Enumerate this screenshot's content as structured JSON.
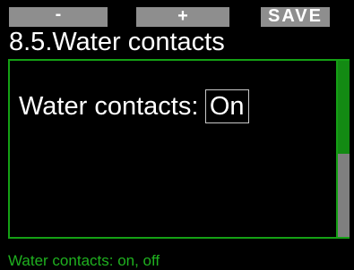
{
  "softkeys": {
    "left_label": "-",
    "middle_label": "+",
    "right_label": "SAVE"
  },
  "header": {
    "title": "8.5.Water contacts"
  },
  "setting": {
    "label": "Water contacts:",
    "value": "On"
  },
  "scrollbar": {
    "thumb_fraction": 0.53
  },
  "footer": {
    "hint": "Water contacts: on, off"
  },
  "colors": {
    "accent_green": "#14a014",
    "hint_green": "#1fb01f",
    "softkey_gray": "#8e8e8e",
    "background": "#000000"
  }
}
